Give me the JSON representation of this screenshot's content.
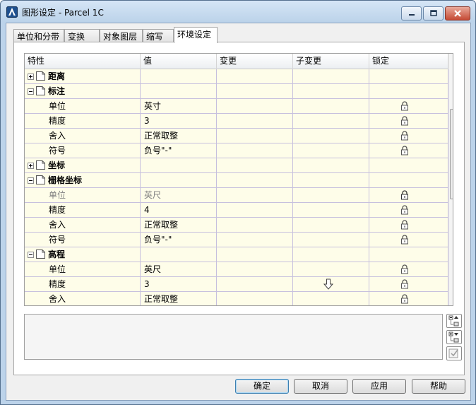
{
  "window": {
    "title": "图形设定 - Parcel 1C"
  },
  "tabs": [
    {
      "label": "单位和分带"
    },
    {
      "label": "变换"
    },
    {
      "label": "对象图层"
    },
    {
      "label": "缩写"
    },
    {
      "label": "环境设定",
      "active": true
    }
  ],
  "grid": {
    "columns": [
      "特性",
      "值",
      "变更",
      "子变更",
      "锁定"
    ],
    "rows": {
      "r0": {
        "property": "距离",
        "kind": "category",
        "expanded": false
      },
      "r1": {
        "property": "标注",
        "kind": "category",
        "expanded": true
      },
      "r2": {
        "property": "单位",
        "value": "英寸",
        "locked": true
      },
      "r3": {
        "property": "精度",
        "value": "3",
        "locked": true
      },
      "r4": {
        "property": "舍入",
        "value": "正常取整",
        "locked": true
      },
      "r5": {
        "property": "符号",
        "value": "负号\"-\"",
        "locked": true
      },
      "r6": {
        "property": "坐标",
        "kind": "category",
        "expanded": false
      },
      "r7": {
        "property": "栅格坐标",
        "kind": "category",
        "expanded": true
      },
      "r8": {
        "property": "单位",
        "value": "英尺",
        "locked": true,
        "disabled": true
      },
      "r9": {
        "property": "精度",
        "value": "4",
        "locked": true
      },
      "r10": {
        "property": "舍入",
        "value": "正常取整",
        "locked": true
      },
      "r11": {
        "property": "符号",
        "value": "负号\"-\"",
        "locked": true
      },
      "r12": {
        "property": "高程",
        "kind": "category",
        "expanded": true
      },
      "r13": {
        "property": "单位",
        "value": "英尺",
        "locked": true
      },
      "r14": {
        "property": "精度",
        "value": "3",
        "locked": true,
        "child_override_icon": "down-arrow-icon"
      },
      "r15": {
        "property": "舍入",
        "value": "正常取整",
        "locked": true
      }
    }
  },
  "buttons": {
    "ok": "确定",
    "cancel": "取消",
    "apply": "应用",
    "help": "帮助"
  },
  "colors": {
    "grid_row_bg": "#fefde9",
    "grid_line": "#c7c0de",
    "default_button_border": "#3c7fb1"
  }
}
